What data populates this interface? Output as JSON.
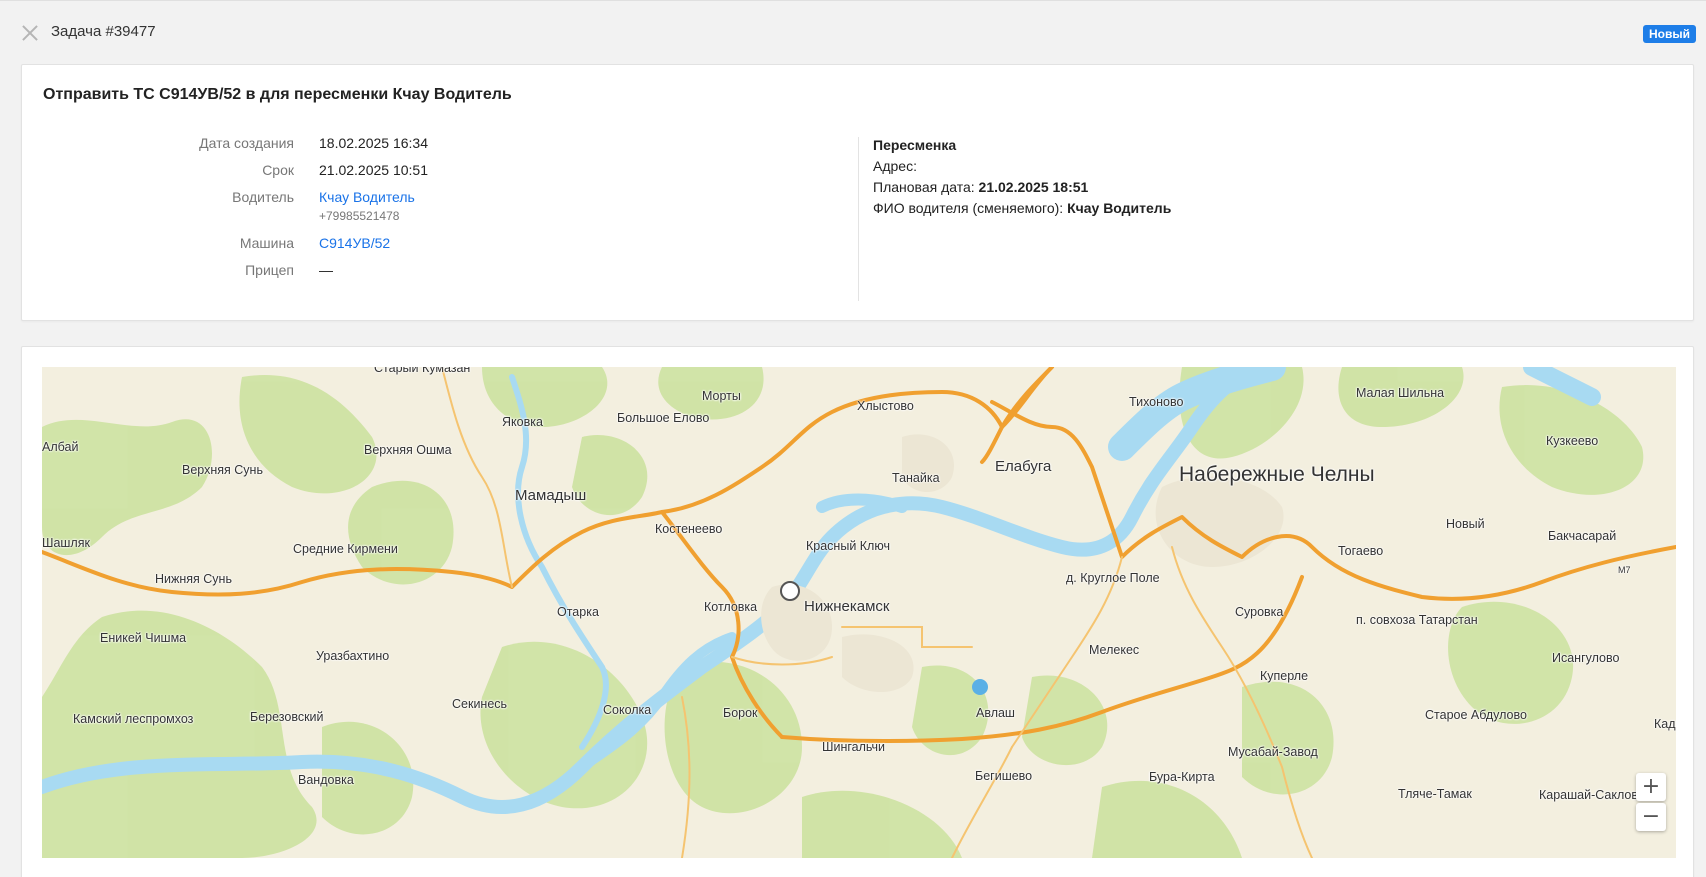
{
  "header": {
    "task_title": "Задача #39477",
    "status_badge": "Новый",
    "badge_color": "#1e7ee8"
  },
  "task": {
    "heading": "Отправить ТС С914УВ/52 в для пересменки Кчау Водитель",
    "fields": [
      {
        "label": "Дата создания",
        "value": "18.02.2025 16:34"
      },
      {
        "label": "Срок",
        "value": "21.02.2025 10:51"
      },
      {
        "label": "Водитель",
        "value": "Кчау Водитель",
        "sub": "+79985521478"
      },
      {
        "label": "Машина",
        "value": "С914УВ/52"
      },
      {
        "label": "Прицеп",
        "value": "—"
      }
    ],
    "details": {
      "title": "Пересменка",
      "address_label": "Адрес:",
      "planned_date_label": "Плановая дата:",
      "planned_date_value": "21.02.2025 18:51",
      "driver_label": "ФИО водителя (сменяемого):",
      "driver_value": "Кчау Водитель"
    }
  },
  "map": {
    "labels": [
      "Старый Кумазан",
      "Морты",
      "Хлыстово",
      "Тихоново",
      "Малая Шильна",
      "Яковка",
      "Большое Елово",
      "Албай",
      "Верхняя Ошма",
      "Верхняя Сунь",
      "Кузкеево",
      "Танайка",
      "Елабуга",
      "Набережные Челны",
      "Мамадыш",
      "Костенеево",
      "Новый",
      "Бакчасарай",
      "Шашляк",
      "Средние Кирмени",
      "Красный Ключ",
      "Тогаево",
      "Нижняя Сунь",
      "д. Круглое Поле",
      "Нижнекамск",
      "Отарка",
      "Котловка",
      "Суровка",
      "п. совхоза Татарстан",
      "Еникей Чишма",
      "Уразбахтино",
      "Мелекес",
      "Исангулово",
      "Секинесь",
      "Соколка",
      "Куперле",
      "Камский леспромхоз",
      "Березовский",
      "Борок",
      "Авлаш",
      "Старое Абдулово",
      "Кадр",
      "Шингальчи",
      "Мусабай-Завод",
      "Вандовка",
      "Бегишево",
      "Бура-Кирта",
      "Тляче-Тамак",
      "Карашай-Саклов",
      "М7"
    ],
    "zoom_in": "+",
    "zoom_out": "−"
  }
}
